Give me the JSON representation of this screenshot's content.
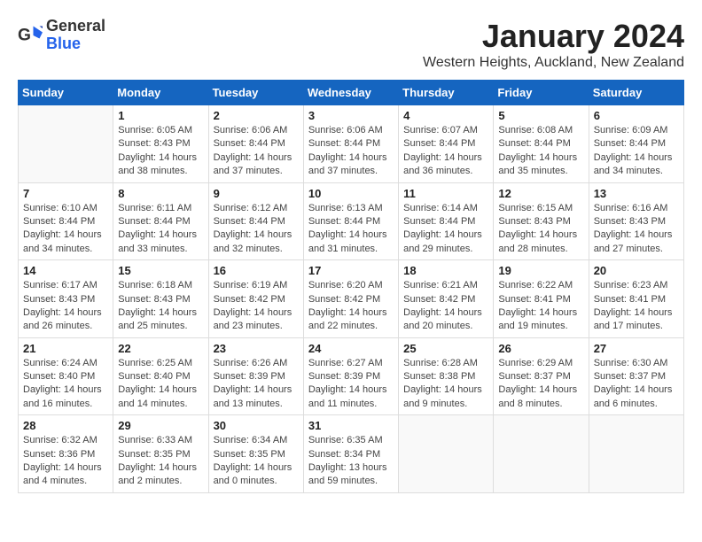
{
  "logo": {
    "general": "General",
    "blue": "Blue"
  },
  "title": "January 2024",
  "subtitle": "Western Heights, Auckland, New Zealand",
  "days_of_week": [
    "Sunday",
    "Monday",
    "Tuesday",
    "Wednesday",
    "Thursday",
    "Friday",
    "Saturday"
  ],
  "weeks": [
    [
      {
        "day": "",
        "detail": ""
      },
      {
        "day": "1",
        "detail": "Sunrise: 6:05 AM\nSunset: 8:43 PM\nDaylight: 14 hours\nand 38 minutes."
      },
      {
        "day": "2",
        "detail": "Sunrise: 6:06 AM\nSunset: 8:44 PM\nDaylight: 14 hours\nand 37 minutes."
      },
      {
        "day": "3",
        "detail": "Sunrise: 6:06 AM\nSunset: 8:44 PM\nDaylight: 14 hours\nand 37 minutes."
      },
      {
        "day": "4",
        "detail": "Sunrise: 6:07 AM\nSunset: 8:44 PM\nDaylight: 14 hours\nand 36 minutes."
      },
      {
        "day": "5",
        "detail": "Sunrise: 6:08 AM\nSunset: 8:44 PM\nDaylight: 14 hours\nand 35 minutes."
      },
      {
        "day": "6",
        "detail": "Sunrise: 6:09 AM\nSunset: 8:44 PM\nDaylight: 14 hours\nand 34 minutes."
      }
    ],
    [
      {
        "day": "7",
        "detail": "Sunrise: 6:10 AM\nSunset: 8:44 PM\nDaylight: 14 hours\nand 34 minutes."
      },
      {
        "day": "8",
        "detail": "Sunrise: 6:11 AM\nSunset: 8:44 PM\nDaylight: 14 hours\nand 33 minutes."
      },
      {
        "day": "9",
        "detail": "Sunrise: 6:12 AM\nSunset: 8:44 PM\nDaylight: 14 hours\nand 32 minutes."
      },
      {
        "day": "10",
        "detail": "Sunrise: 6:13 AM\nSunset: 8:44 PM\nDaylight: 14 hours\nand 31 minutes."
      },
      {
        "day": "11",
        "detail": "Sunrise: 6:14 AM\nSunset: 8:44 PM\nDaylight: 14 hours\nand 29 minutes."
      },
      {
        "day": "12",
        "detail": "Sunrise: 6:15 AM\nSunset: 8:43 PM\nDaylight: 14 hours\nand 28 minutes."
      },
      {
        "day": "13",
        "detail": "Sunrise: 6:16 AM\nSunset: 8:43 PM\nDaylight: 14 hours\nand 27 minutes."
      }
    ],
    [
      {
        "day": "14",
        "detail": "Sunrise: 6:17 AM\nSunset: 8:43 PM\nDaylight: 14 hours\nand 26 minutes."
      },
      {
        "day": "15",
        "detail": "Sunrise: 6:18 AM\nSunset: 8:43 PM\nDaylight: 14 hours\nand 25 minutes."
      },
      {
        "day": "16",
        "detail": "Sunrise: 6:19 AM\nSunset: 8:42 PM\nDaylight: 14 hours\nand 23 minutes."
      },
      {
        "day": "17",
        "detail": "Sunrise: 6:20 AM\nSunset: 8:42 PM\nDaylight: 14 hours\nand 22 minutes."
      },
      {
        "day": "18",
        "detail": "Sunrise: 6:21 AM\nSunset: 8:42 PM\nDaylight: 14 hours\nand 20 minutes."
      },
      {
        "day": "19",
        "detail": "Sunrise: 6:22 AM\nSunset: 8:41 PM\nDaylight: 14 hours\nand 19 minutes."
      },
      {
        "day": "20",
        "detail": "Sunrise: 6:23 AM\nSunset: 8:41 PM\nDaylight: 14 hours\nand 17 minutes."
      }
    ],
    [
      {
        "day": "21",
        "detail": "Sunrise: 6:24 AM\nSunset: 8:40 PM\nDaylight: 14 hours\nand 16 minutes."
      },
      {
        "day": "22",
        "detail": "Sunrise: 6:25 AM\nSunset: 8:40 PM\nDaylight: 14 hours\nand 14 minutes."
      },
      {
        "day": "23",
        "detail": "Sunrise: 6:26 AM\nSunset: 8:39 PM\nDaylight: 14 hours\nand 13 minutes."
      },
      {
        "day": "24",
        "detail": "Sunrise: 6:27 AM\nSunset: 8:39 PM\nDaylight: 14 hours\nand 11 minutes."
      },
      {
        "day": "25",
        "detail": "Sunrise: 6:28 AM\nSunset: 8:38 PM\nDaylight: 14 hours\nand 9 minutes."
      },
      {
        "day": "26",
        "detail": "Sunrise: 6:29 AM\nSunset: 8:37 PM\nDaylight: 14 hours\nand 8 minutes."
      },
      {
        "day": "27",
        "detail": "Sunrise: 6:30 AM\nSunset: 8:37 PM\nDaylight: 14 hours\nand 6 minutes."
      }
    ],
    [
      {
        "day": "28",
        "detail": "Sunrise: 6:32 AM\nSunset: 8:36 PM\nDaylight: 14 hours\nand 4 minutes."
      },
      {
        "day": "29",
        "detail": "Sunrise: 6:33 AM\nSunset: 8:35 PM\nDaylight: 14 hours\nand 2 minutes."
      },
      {
        "day": "30",
        "detail": "Sunrise: 6:34 AM\nSunset: 8:35 PM\nDaylight: 14 hours\nand 0 minutes."
      },
      {
        "day": "31",
        "detail": "Sunrise: 6:35 AM\nSunset: 8:34 PM\nDaylight: 13 hours\nand 59 minutes."
      },
      {
        "day": "",
        "detail": ""
      },
      {
        "day": "",
        "detail": ""
      },
      {
        "day": "",
        "detail": ""
      }
    ]
  ]
}
